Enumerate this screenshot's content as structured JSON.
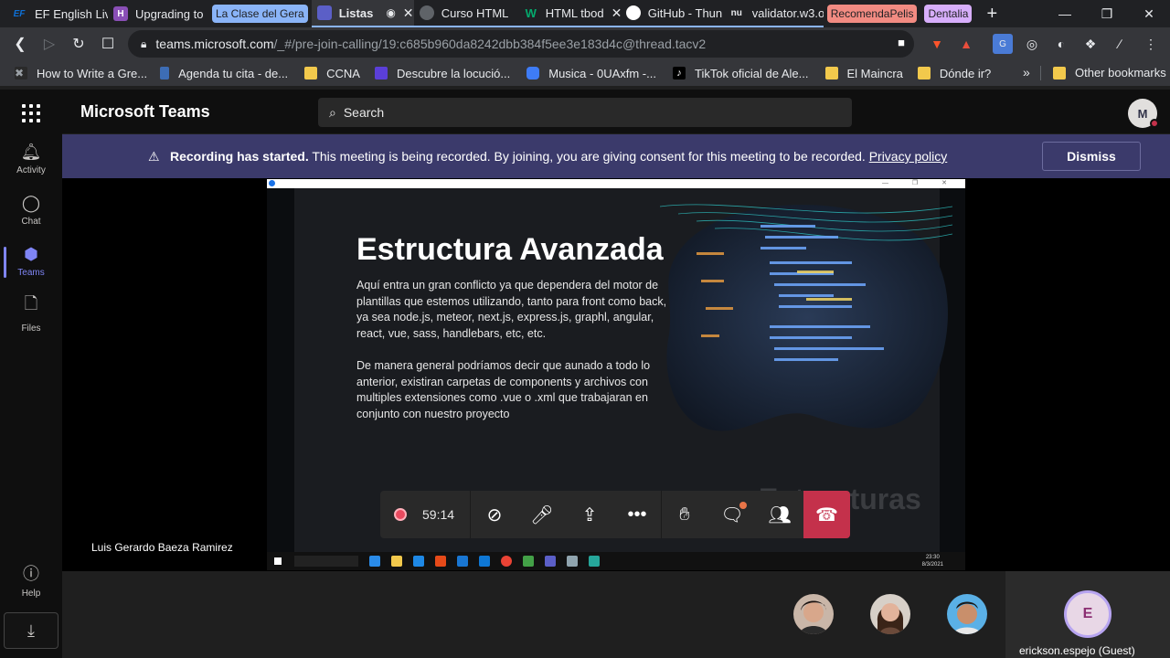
{
  "browser": {
    "tabs": [
      {
        "title": "EF English Live",
        "icon_text": "EF",
        "icon_color": "#0e6fd4"
      },
      {
        "title": "Upgrading to",
        "icon_text": "H",
        "icon_color": "#8a4fb6"
      },
      {
        "title": "La Clase del Gera",
        "group": true
      },
      {
        "title": "Listas",
        "icon_color": "#5b5fc7"
      },
      {
        "title": "Curso HTML",
        "icon_color": "#9aa0a6"
      },
      {
        "title": "HTML tbod",
        "icon_text": "W",
        "icon_color": "#04aa6d"
      },
      {
        "title": "GitHub - Thun",
        "icon_color": "#ffffff"
      },
      {
        "title": "validator.w3.o",
        "icon_text": "nu",
        "icon_color": "#9aa0a6"
      },
      {
        "title": "RecomendaPelis",
        "group": true
      },
      {
        "title": "Dentalia",
        "group": true
      }
    ],
    "new_tab": "+",
    "url_host": "teams.microsoft.com",
    "url_path": "/_#/pre-join-calling/19:c685b960da8242dbb384f5ee3e183d4c@thread.tacv2",
    "bookmarks": [
      {
        "label": "How to Write a Gre...",
        "color": "#9aa0a6"
      },
      {
        "label": "Agenda tu cita - de...",
        "color": "#3d6db5"
      },
      {
        "label": "CCNA",
        "color": "folder"
      },
      {
        "label": "Descubre la locució...",
        "color": "#5b3fd8"
      },
      {
        "label": "Musica - 0UAxfm -...",
        "color": "#3e7cf7"
      },
      {
        "label": "TikTok oficial de Ale...",
        "color": "#000000"
      },
      {
        "label": "El Maincra",
        "color": "folder"
      },
      {
        "label": "Dónde ir?",
        "color": "folder"
      }
    ],
    "bookmarks_more": "»",
    "other_bookmarks": "Other bookmarks"
  },
  "teams": {
    "brand": "Microsoft Teams",
    "search_placeholder": "Search",
    "avatar_initial": "M",
    "rail": [
      {
        "label": "Activity",
        "icon": "bell-icon"
      },
      {
        "label": "Chat",
        "icon": "chat-icon"
      },
      {
        "label": "Teams",
        "icon": "teams-icon",
        "active": true
      },
      {
        "label": "Files",
        "icon": "file-icon"
      },
      {
        "label": "Help",
        "icon": "help-icon"
      }
    ],
    "banner": {
      "bold": "Recording has started.",
      "text": " This meeting is being recorded. By joining, you are giving consent for this meeting to be recorded. ",
      "link": "Privacy policy",
      "dismiss": "Dismiss"
    },
    "slide": {
      "heading": "Estructura Avanzada",
      "p1": "Aquí entra un gran conflicto ya que dependera del motor de plantillas que estemos utilizando, tanto para front como back, ya sea node.js, meteor, next.js, express.js, graphl, angular, react, vue, sass, handlebars, etc, etc.",
      "p2": "De manera general podríamos decir que aunado a todo lo anterior, existiran carpetas de components y archivos con multiples extensiones como .vue o .xml que trabajaran en conjunto con nuestro proyecto",
      "watermark": "Estructuras",
      "clock_time": "23:30",
      "clock_date": "8/3/2021"
    },
    "presenter_name": "Luis Gerardo Baeza Ramirez",
    "call": {
      "timer": "59:14"
    },
    "guest": {
      "initial": "E",
      "name": "erickson.espejo (Guest)"
    }
  }
}
